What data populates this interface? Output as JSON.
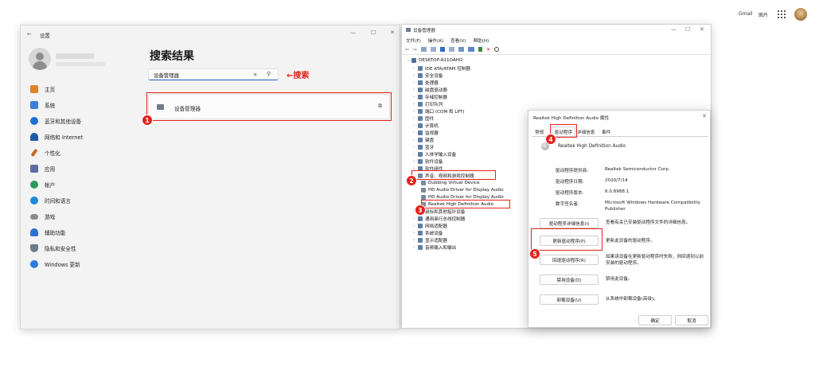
{
  "browser_bar": {
    "gmail": "Gmail",
    "images": "图片"
  },
  "settings": {
    "title": "设置",
    "back": "←",
    "search_results_title": "搜索结果",
    "search_value": "设备管理器",
    "search_annotation": "←搜索",
    "result_item": "设备管理器",
    "nav": [
      "主页",
      "系统",
      "蓝牙和其他设备",
      "网络和 Internet",
      "个性化",
      "应用",
      "帐户",
      "时间和语言",
      "游戏",
      "辅助功能",
      "隐私和安全性",
      "Windows 更新"
    ],
    "nav_colors": [
      "#e0812c",
      "#3b7fd6",
      "#1d6fd1",
      "#1f5aa8",
      "#c36a2d",
      "#5b6ea3",
      "#2f9b5a",
      "#1c8ad6",
      "#8b8b8b",
      "#2b6fd1",
      "#6e7a8a",
      "#2d7bd8"
    ]
  },
  "devmgr": {
    "title": "设备管理器",
    "menu": [
      "文件(F)",
      "操作(A)",
      "查看(V)",
      "帮助(H)"
    ],
    "root": "DESKTOP-A11OAHO",
    "tree": [
      "IDE ATA/ATAPI 控制器",
      "安全设备",
      "处理器",
      "磁盘驱动器",
      "存储控制器",
      "打印队列",
      "端口 (COM 和 LPT)",
      "固件",
      "计算机",
      "监视器",
      "键盘",
      "蓝牙",
      "人体学输入设备",
      "软件设备",
      "软件组件",
      "声音、视频和游戏控制器",
      "Dubbing Virtual Device",
      "HD Audio Driver for Display Audio",
      "HD Audio Driver for Display Audio",
      "Realtek High Definition Audio",
      "鼠标和其他指针设备",
      "通用串行总线控制器",
      "网络适配器",
      "系统设备",
      "显示适配器",
      "音频输入和输出"
    ]
  },
  "dialog": {
    "title": "Realtek High Definition Audio 属性",
    "tabs": [
      "常规",
      "驱动程序",
      "详细信息",
      "事件"
    ],
    "device_name": "Realtek High Definition Audio",
    "props": [
      {
        "label": "驱动程序提供商:",
        "value": "Realtek Semiconductor Corp."
      },
      {
        "label": "驱动程序日期:",
        "value": "2020/7/14"
      },
      {
        "label": "驱动程序版本:",
        "value": "6.0.8988.1"
      },
      {
        "label": "数字签名者:",
        "value": "Microsoft Windows Hardware Compatibility Publisher"
      }
    ],
    "buttons": [
      {
        "label": "驱动程序详细信息(I)",
        "desc": "查看有关已安装驱动程序文件的详细信息。"
      },
      {
        "label": "更新驱动程序(P)",
        "desc": "更新此设备的驱动程序。"
      },
      {
        "label": "回退驱动程序(R)",
        "desc": "如果该设备在更新驱动程序时失败，则回退到以前安装的驱动程序。"
      },
      {
        "label": "禁用设备(D)",
        "desc": "禁用此设备。"
      },
      {
        "label": "卸载设备(U)",
        "desc": "从系统中卸载设备(高级)。"
      }
    ],
    "ok": "确定",
    "cancel": "取消"
  },
  "badges": [
    "1",
    "2",
    "3",
    "4",
    "5"
  ],
  "accent_red": "#e2231a"
}
